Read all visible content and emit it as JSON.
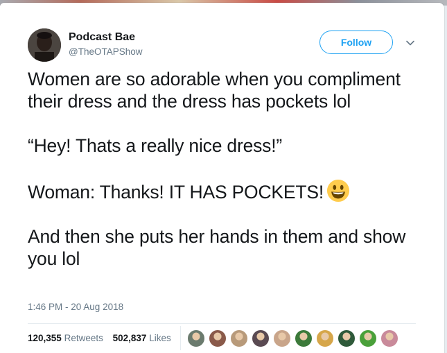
{
  "user": {
    "display_name": "Podcast Bae",
    "handle": "@TheOTAPShow"
  },
  "follow_button": {
    "label": "Follow"
  },
  "tweet": {
    "lines": [
      "Women are so adorable when you compliment their dress and the dress has pockets lol",
      "“Hey! Thats a really nice dress!”",
      "Woman: Thanks! IT HAS POCKETS!",
      "And then she puts her hands in them and show you lol"
    ],
    "emoji": "smiley-face"
  },
  "timestamp": "1:46 PM - 20 Aug 2018",
  "stats": {
    "retweets_count": "120,355",
    "retweets_label": "Retweets",
    "likes_count": "502,837",
    "likes_label": "Likes"
  },
  "likers": [
    {
      "name": "liker-1",
      "color": "#6b7b6e"
    },
    {
      "name": "liker-2",
      "color": "#8a5a4a"
    },
    {
      "name": "liker-3",
      "color": "#b89a7a"
    },
    {
      "name": "liker-4",
      "color": "#5a4a52"
    },
    {
      "name": "liker-5",
      "color": "#c9a58a"
    },
    {
      "name": "liker-6",
      "color": "#3c7a3a"
    },
    {
      "name": "liker-7",
      "color": "#d6a64a"
    },
    {
      "name": "liker-8",
      "color": "#2f5a3a"
    },
    {
      "name": "liker-9",
      "color": "#4aa03a"
    },
    {
      "name": "liker-10",
      "color": "#c98a9a"
    }
  ],
  "colors": {
    "accent": "#1da1f2",
    "text": "#14171a",
    "muted": "#657786"
  }
}
